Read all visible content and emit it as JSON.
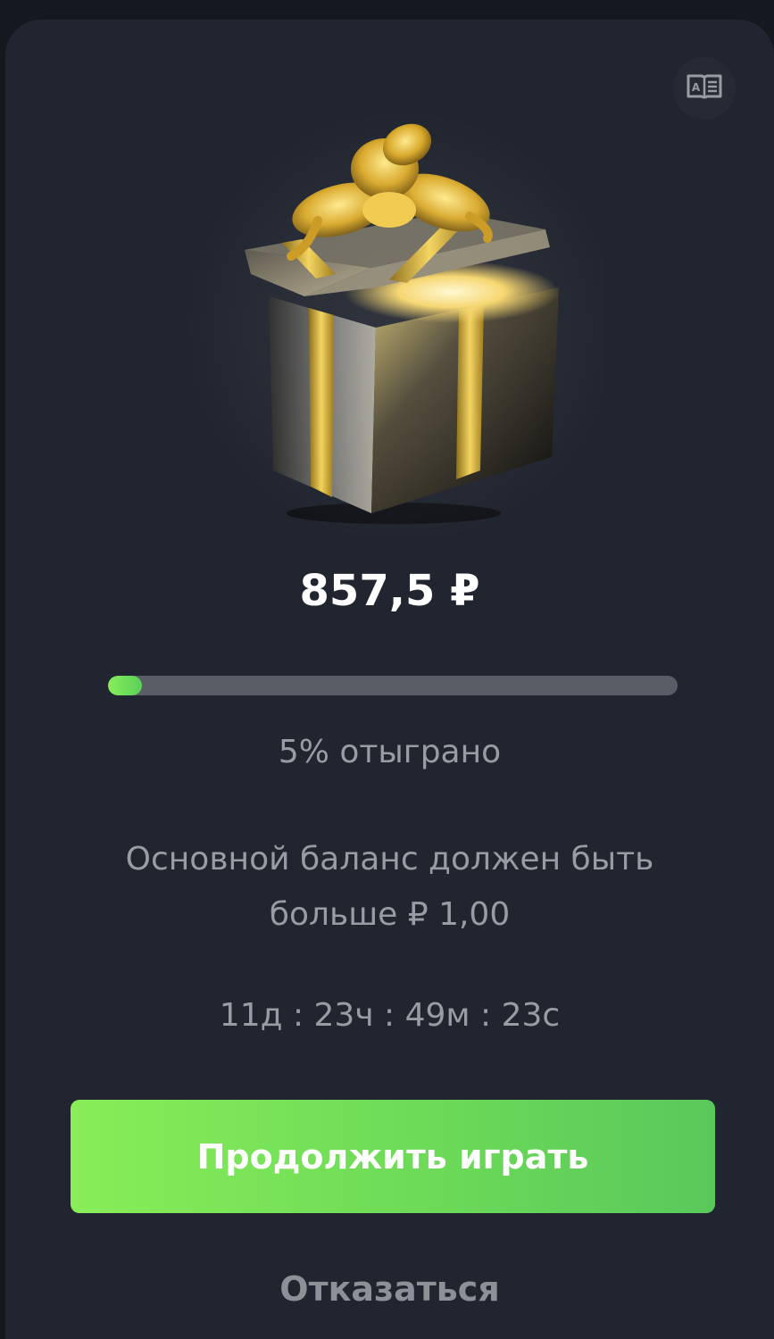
{
  "bonus": {
    "amount": "857,5 ₽",
    "progress_percent": 5,
    "progress_label": "5% отыграно",
    "condition_text": "Основной баланс должен быть больше ₽ 1,00",
    "timer": "11д : 23ч : 49м : 23с"
  },
  "actions": {
    "continue_label": "Продолжить играть",
    "decline_label": "Отказаться"
  },
  "icons": {
    "rules": "book-icon",
    "gift": "gift-box-icon"
  },
  "colors": {
    "modal_background": "#21252f",
    "accent_green": "#6fdc58",
    "progress_track": "#5a5d66",
    "muted_text": "#9a9ca3"
  }
}
